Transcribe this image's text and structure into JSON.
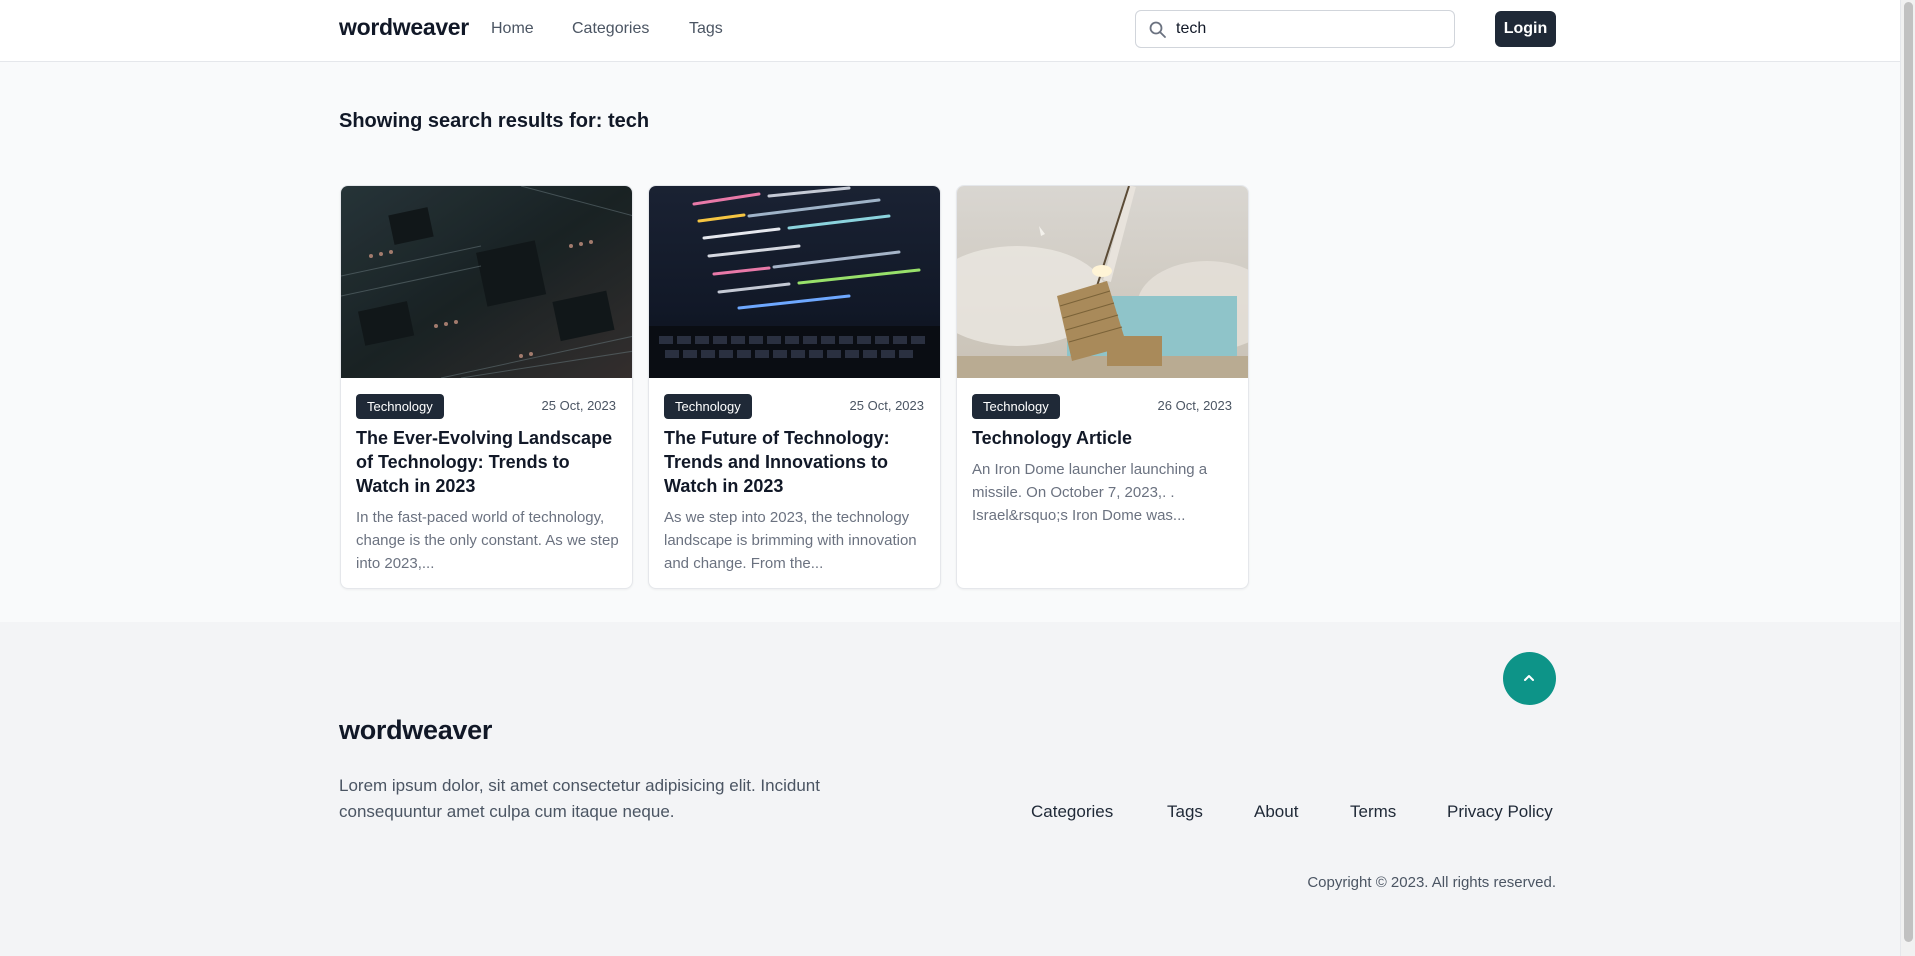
{
  "header": {
    "logo": "wordweaver",
    "nav": [
      "Home",
      "Categories",
      "Tags"
    ],
    "search": {
      "value": "tech",
      "icon": "search-icon"
    },
    "login_label": "Login"
  },
  "results": {
    "heading": "Showing search results for: tech"
  },
  "cards": [
    {
      "category": "Technology",
      "date": "25 Oct, 2023",
      "title": "The Ever-Evolving Landscape of Technology: Trends to Watch in 2023",
      "excerpt": "In the fast-paced world of technology, change is the only constant. As we step into 2023,...",
      "image": "circuit-board-image"
    },
    {
      "category": "Technology",
      "date": "25 Oct, 2023",
      "title": "The Future of Technology: Trends and Innovations to Watch in 2023",
      "excerpt": "As we step into 2023, the technology landscape is brimming with innovation and change. From the...",
      "image": "laptop-code-image"
    },
    {
      "category": "Technology",
      "date": "26 Oct, 2023",
      "title": "Technology Article",
      "excerpt": "An Iron Dome launcher launching a missile. On October 7, 2023,. . Israel&rsquo;s Iron Dome was...",
      "image": "missile-launcher-image"
    }
  ],
  "footer": {
    "logo": "wordweaver",
    "description": "Lorem ipsum dolor, sit amet consectetur adipisicing elit. Incidunt consequuntur amet culpa cum itaque neque.",
    "links": [
      "Categories",
      "Tags",
      "About",
      "Terms",
      "Privacy Policy"
    ],
    "copyright": "Copyright © 2023. All rights reserved.",
    "scroll_top_icon": "chevron-up-icon"
  },
  "colors": {
    "primary_dark": "#1f2937",
    "accent_teal": "#0d9488",
    "background": "#f9fafb"
  }
}
